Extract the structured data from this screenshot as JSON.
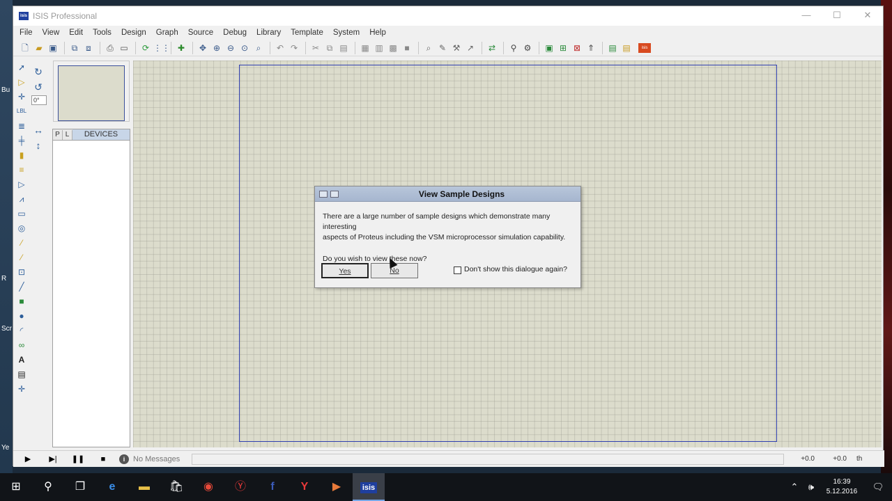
{
  "window": {
    "title": "ISIS Professional",
    "app_icon_text": "isis",
    "controls": {
      "minimize": "—",
      "maximize": "☐",
      "close": "✕"
    }
  },
  "menubar": {
    "items": [
      "File",
      "View",
      "Edit",
      "Tools",
      "Design",
      "Graph",
      "Source",
      "Debug",
      "Library",
      "Template",
      "System",
      "Help"
    ]
  },
  "left_panel": {
    "angle": "0°",
    "devices_tabs": [
      "P",
      "L"
    ],
    "devices_title": "DEVICES"
  },
  "dialog": {
    "title": "View Sample Designs",
    "body_line1": "There are a large number of sample designs which demonstrate many interesting",
    "body_line2": "aspects of Proteus including the VSM microprocessor simulation capability.",
    "question": "Do you wish to view these now?",
    "yes_label": "Yes",
    "no_label": "No",
    "checkbox_label": "Don't show this dialogue again?",
    "checkbox_checked": false
  },
  "statusbar": {
    "messages": "No Messages",
    "x_coord": "+0.0",
    "y_coord": "+0.0",
    "unit": "th"
  },
  "taskbar": {
    "time": "16:39",
    "date": "5.12.2016",
    "active_app": "isis"
  },
  "desktop_fragments": [
    "Bu",
    "R",
    "Scr",
    "Ye"
  ]
}
